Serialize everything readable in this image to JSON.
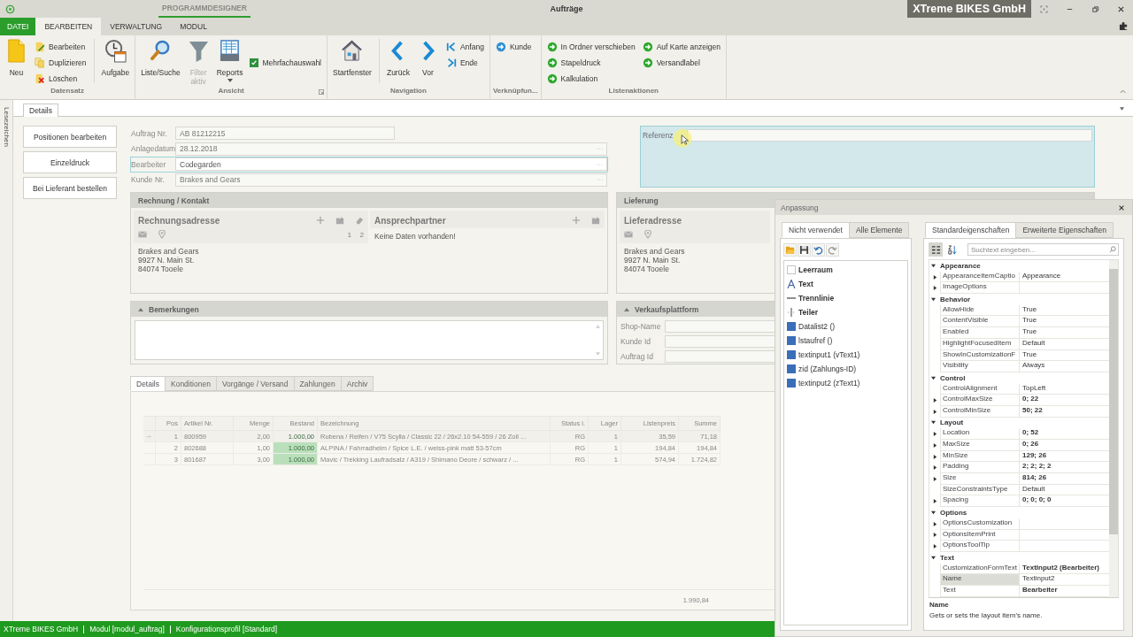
{
  "title_bar": {
    "context_tab": "PROGRAMMDESIGNER",
    "title": "Aufträge",
    "company": "XTreme BIKES GmbH"
  },
  "ribbon_tabs": [
    {
      "label": "DATEI",
      "kind": "file",
      "selected": false
    },
    {
      "label": "BEARBEITEN",
      "kind": "tab",
      "selected": true
    },
    {
      "label": "VERWALTUNG",
      "kind": "tab",
      "selected": false
    },
    {
      "label": "MODUL",
      "kind": "tab",
      "selected": false
    }
  ],
  "ribbon_groups": [
    {
      "title": "Datensatz",
      "launcher": false,
      "columns": [
        {
          "kind": "large",
          "label": "Neu",
          "disabled": false,
          "dropdown": false
        },
        {
          "kind": "stack",
          "buttons": [
            {
              "label": "Bearbeiten"
            },
            {
              "label": "Duplizieren"
            },
            {
              "label": "Löschen"
            }
          ]
        },
        {
          "kind": "separator"
        },
        {
          "kind": "large",
          "label": "Aufgabe",
          "disabled": false,
          "dropdown": false
        }
      ]
    },
    {
      "title": "Ansicht",
      "launcher": true,
      "columns": [
        {
          "kind": "large",
          "label": "Liste/Suche",
          "disabled": false,
          "dropdown": false
        },
        {
          "kind": "large",
          "label": "Filter aktiv",
          "disabled": true,
          "dropdown": false
        },
        {
          "kind": "large",
          "label": "Reports",
          "disabled": false,
          "dropdown": true
        },
        {
          "kind": "check",
          "label": "Mehrfachauswahl",
          "checked": true
        }
      ]
    },
    {
      "title": "Navigation",
      "launcher": false,
      "columns": [
        {
          "kind": "large",
          "label": "Startfenster",
          "disabled": false,
          "dropdown": false
        },
        {
          "kind": "separator"
        },
        {
          "kind": "large",
          "label": "Zurück",
          "disabled": false,
          "dropdown": false
        },
        {
          "kind": "large",
          "label": "Vor",
          "disabled": false,
          "dropdown": false
        },
        {
          "kind": "stack",
          "buttons": [
            {
              "label": "Anfang"
            },
            {
              "label": "Ende"
            }
          ]
        }
      ]
    },
    {
      "title": "Verknüpfun...",
      "launcher": false,
      "columns": [
        {
          "kind": "stack",
          "buttons": [
            {
              "label": "Kunde"
            }
          ]
        }
      ]
    },
    {
      "title": "Listenaktionen",
      "launcher": false,
      "columns": [
        {
          "kind": "stack",
          "buttons": [
            {
              "label": "In Ordner verschieben"
            },
            {
              "label": "Stapeldruck"
            },
            {
              "label": "Kalkulation"
            }
          ]
        },
        {
          "kind": "stack",
          "buttons": [
            {
              "label": "Auf Karte anzeigen"
            },
            {
              "label": "Versandlabel"
            }
          ]
        }
      ]
    }
  ],
  "bookmark_strip": "Lesezeichen",
  "doc_tabs": [
    {
      "label": "Details",
      "selected": true
    }
  ],
  "action_buttons": [
    "Positionen bearbeiten",
    "Einzeldruck",
    "Bei Lieferant bestellen"
  ],
  "fields": [
    {
      "label": "Auftrag Nr.",
      "value": "AB 81212215",
      "kind": "text",
      "selected": false
    },
    {
      "label": "Anlagedatum",
      "value": "28.12.2018",
      "kind": "picker",
      "selected": false
    },
    {
      "label": "Bearbeiter",
      "value": "Codegarden",
      "kind": "picker",
      "selected": true
    },
    {
      "label": "Kunde Nr.",
      "value": "Brakes and Gears",
      "kind": "picker",
      "selected": false
    }
  ],
  "reference": {
    "label": "Referenz",
    "highlighted": true
  },
  "invoice_panel": {
    "title": "Rechnung / Kontakt",
    "address": {
      "title": "Rechnungsadresse",
      "pages": [
        "1",
        "2"
      ],
      "lines": [
        "Brakes and Gears",
        "9927 N. Main St.",
        "84074 Tooele"
      ]
    },
    "contact": {
      "title": "Ansprechpartner",
      "empty_text": "Keine Daten vorhanden!"
    }
  },
  "delivery_panel": {
    "title": "Lieferung",
    "address": {
      "title": "Lieferadresse",
      "lines": [
        "Brakes and Gears",
        "9927 N. Main St.",
        "84074 Tooele"
      ]
    }
  },
  "remarks": {
    "title": "Bemerkungen",
    "expanded": true
  },
  "sales_platform": {
    "title": "Verkaufsplattform",
    "expanded": true,
    "fields": [
      "Shop-Name",
      "Kunde Id",
      "Auftrag Id"
    ]
  },
  "detail_tabs": [
    {
      "label": "Details",
      "selected": true
    },
    {
      "label": "Konditionen",
      "selected": false
    },
    {
      "label": "Vorgänge / Versand",
      "selected": false
    },
    {
      "label": "Zahlungen",
      "selected": false
    },
    {
      "label": "Archiv",
      "selected": false
    }
  ],
  "positions_table": {
    "columns": [
      "Pos",
      "Artikel Nr.",
      "Menge",
      "Bestand",
      "Bezeichnung",
      "Status i.",
      "Lager",
      "Listenpreis",
      "Summe"
    ],
    "rows": [
      {
        "current": true,
        "cells": [
          "1",
          "800959",
          "2,00",
          "1.000,00",
          "Rubena / Reifen / V75 Scylla / Classic 22 / 26x2.10 54-559 / 26 Zoll ...",
          "RG",
          "1",
          "35,59",
          "71,18"
        ]
      },
      {
        "current": false,
        "cells": [
          "2",
          "802688",
          "1,00",
          "1.000,00",
          "ALPINA / Fahrradhelm / Spice L.E. / weiss-pink matt 53-57cm",
          "RG",
          "1",
          "194,84",
          "194,84"
        ]
      },
      {
        "current": false,
        "cells": [
          "3",
          "801687",
          "3,00",
          "1.000,00",
          "Mavic / Trekking Laufradsatz / A319 / Shimano Deore / schwarz / ...",
          "RG",
          "1",
          "574,94",
          "1.724,82"
        ]
      }
    ],
    "total": "1.990,84"
  },
  "customization": {
    "title": "Anpassung",
    "left_tabs": [
      {
        "label": "Nicht verwendet",
        "selected": true
      },
      {
        "label": "Alle Elemente",
        "selected": false
      }
    ],
    "items": [
      {
        "label": "Leerraum",
        "kind": "space"
      },
      {
        "label": "Text",
        "kind": "text"
      },
      {
        "label": "Trennlinie",
        "kind": "separator"
      },
      {
        "label": "Teiler",
        "kind": "splitter"
      },
      {
        "label": "Datalist2 ()",
        "kind": "field"
      },
      {
        "label": "lstaufref ()",
        "kind": "field"
      },
      {
        "label": "textinput1 (vText1)",
        "kind": "field"
      },
      {
        "label": "zid (Zahlungs-ID)",
        "kind": "field"
      },
      {
        "label": "textinput2 (zText1)",
        "kind": "field"
      }
    ],
    "right_tabs": [
      {
        "label": "Standardeigenschaften",
        "selected": true
      },
      {
        "label": "Erweiterte Eigenschaften",
        "selected": false
      }
    ],
    "view_buttons": [
      {
        "kind": "categorized",
        "selected": true
      },
      {
        "kind": "alphabetical",
        "selected": false
      }
    ],
    "search_placeholder": "Suchtext eingeben...",
    "categories": [
      {
        "name": "Appearance",
        "expanded": true,
        "properties": [
          {
            "name": "AppearanceItemCaptio",
            "value": "Appearance",
            "expandable": true,
            "modified": false,
            "selected": false
          },
          {
            "name": "ImageOptions",
            "expandable": true,
            "modified": false,
            "selected": false
          }
        ]
      },
      {
        "name": "Behavior",
        "expanded": true,
        "properties": [
          {
            "name": "AllowHide",
            "value": "True",
            "expandable": false,
            "modified": false,
            "selected": false
          },
          {
            "name": "ContentVisible",
            "value": "True",
            "expandable": false,
            "modified": false,
            "selected": false
          },
          {
            "name": "Enabled",
            "value": "True",
            "expandable": false,
            "modified": false,
            "selected": false
          },
          {
            "name": "HighlightFocusedItem",
            "value": "Default",
            "expandable": false,
            "modified": false,
            "selected": false
          },
          {
            "name": "ShowInCustomizationF",
            "value": "True",
            "expandable": false,
            "modified": false,
            "selected": false
          },
          {
            "name": "Visibility",
            "value": "Always",
            "expandable": false,
            "modified": false,
            "selected": false
          }
        ]
      },
      {
        "name": "Control",
        "expanded": true,
        "properties": [
          {
            "name": "ControlAlignment",
            "value": "TopLeft",
            "expandable": false,
            "modified": false,
            "selected": false
          },
          {
            "name": "ControlMaxSize",
            "value": "0; 22",
            "expandable": true,
            "modified": true,
            "selected": false
          },
          {
            "name": "ControlMinSize",
            "value": "50; 22",
            "expandable": true,
            "modified": true,
            "selected": false
          }
        ]
      },
      {
        "name": "Layout",
        "expanded": true,
        "properties": [
          {
            "name": "Location",
            "value": "0; 52",
            "expandable": true,
            "modified": true,
            "selected": false
          },
          {
            "name": "MaxSize",
            "value": "0; 26",
            "expandable": true,
            "modified": true,
            "selected": false
          },
          {
            "name": "MinSize",
            "value": "129; 26",
            "expandable": true,
            "modified": true,
            "selected": false
          },
          {
            "name": "Padding",
            "value": "2; 2; 2; 2",
            "expandable": true,
            "modified": true,
            "selected": false
          },
          {
            "name": "Size",
            "value": "814; 26",
            "expandable": true,
            "modified": true,
            "selected": false
          },
          {
            "name": "SizeConstraintsType",
            "value": "Default",
            "expandable": false,
            "modified": false,
            "selected": false
          },
          {
            "name": "Spacing",
            "value": "0; 0; 0; 0",
            "expandable": true,
            "modified": true,
            "selected": false
          }
        ]
      },
      {
        "name": "Options",
        "expanded": true,
        "properties": [
          {
            "name": "OptionsCustomization",
            "expandable": true,
            "modified": false,
            "selected": false
          },
          {
            "name": "OptionsItemPrint",
            "expandable": true,
            "modified": false,
            "selected": false
          },
          {
            "name": "OptionsToolTip",
            "expandable": true,
            "modified": false,
            "selected": false
          }
        ]
      },
      {
        "name": "Text",
        "expanded": true,
        "properties": [
          {
            "name": "CustomizationFormText",
            "value": "TextInput2 (Bearbeiter)",
            "expandable": false,
            "modified": true,
            "selected": false
          },
          {
            "name": "Name",
            "value": "Textinput2",
            "expandable": false,
            "modified": false,
            "selected": true
          },
          {
            "name": "Text",
            "value": "Bearbeiter",
            "expandable": false,
            "modified": true,
            "selected": false
          }
        ]
      }
    ],
    "description": {
      "title": "Name",
      "text": "Gets or sets the layout item's name."
    }
  },
  "status_bar": [
    "XTreme BIKES GmbH",
    "Modul [modul_auftrag]",
    "Konfigurationsprofil [Standard]"
  ]
}
